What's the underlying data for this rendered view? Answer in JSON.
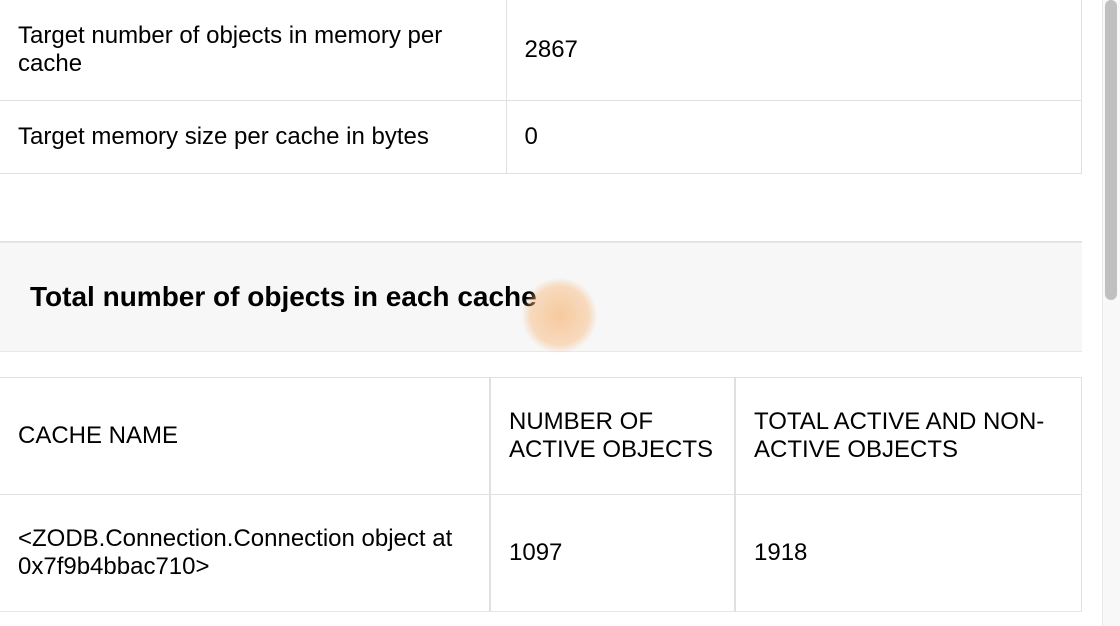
{
  "upperTable": {
    "rows": [
      {
        "label": "Target number of objects in memory per cache",
        "value": "2867"
      },
      {
        "label": "Target memory size per cache in bytes",
        "value": "0"
      }
    ]
  },
  "sectionTitle": "Total number of objects in each cache",
  "cacheTable": {
    "headers": {
      "name": "CACHE NAME",
      "active": "NUMBER OF ACTIVE OBJECTS",
      "total": "TOTAL ACTIVE AND NON-ACTIVE OBJECTS"
    },
    "rows": [
      {
        "name": "<ZODB.Connection.Connection object at 0x7f9b4bbac710>",
        "active": "1097",
        "total": "1918"
      }
    ]
  }
}
